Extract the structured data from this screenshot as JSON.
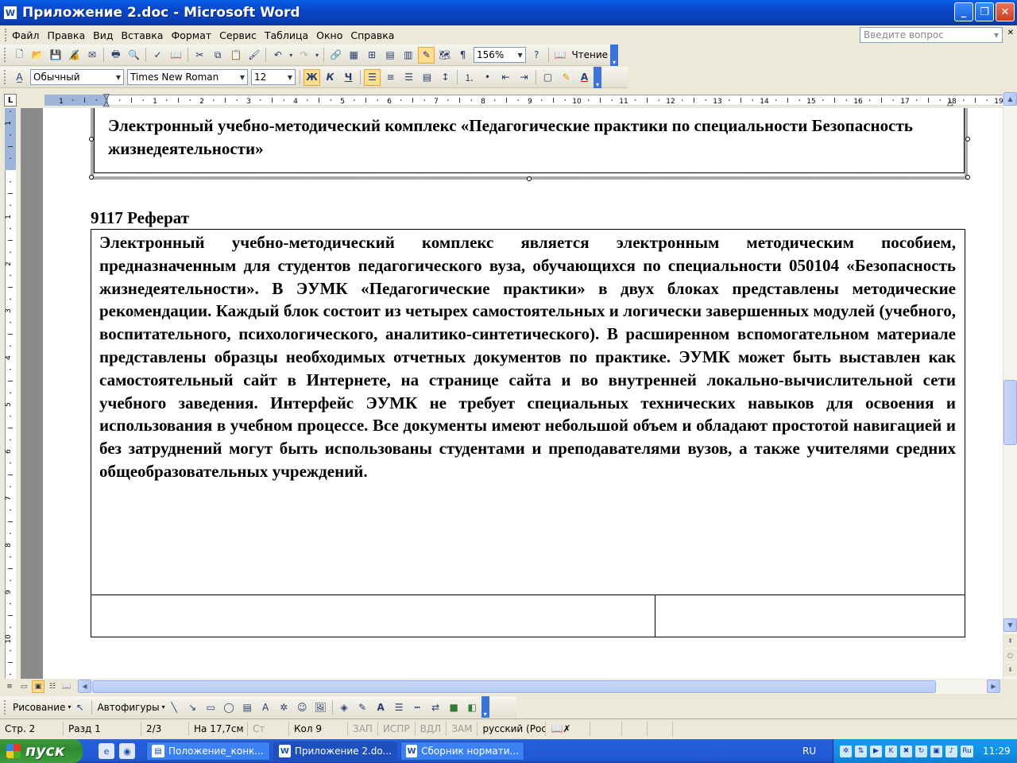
{
  "window": {
    "title": "Приложение 2.doc - Microsoft Word",
    "app_icon": "word-doc-icon"
  },
  "menu": {
    "items": [
      "Файл",
      "Правка",
      "Вид",
      "Вставка",
      "Формат",
      "Сервис",
      "Таблица",
      "Окно",
      "Справка"
    ],
    "ask_placeholder": "Введите вопрос"
  },
  "standard_toolbar": {
    "zoom": "156%",
    "read_label": "Чтение"
  },
  "format_toolbar": {
    "style": "Обычный",
    "font": "Times New Roman",
    "size": "12",
    "bold": "Ж",
    "italic": "К",
    "underline": "Ч"
  },
  "ruler": {
    "corner": "L",
    "numbers": [
      "1",
      "1",
      "2",
      "3",
      "4",
      "5",
      "6",
      "7",
      "8",
      "9",
      "10",
      "11",
      "12",
      "13",
      "14",
      "15",
      "16",
      "17",
      "18",
      "19"
    ],
    "vnumbers": [
      "1",
      "1",
      "2",
      "3",
      "4",
      "5",
      "6",
      "7",
      "8",
      "9",
      "10",
      "11",
      "12"
    ]
  },
  "document": {
    "header_text": "Электронный учебно-методический комплекс «Педагогические практики по специальности Безопасность жизнедеятельности»",
    "section_title": "9117 Реферат",
    "body": "Электронный учебно-методический комплекс является электронным методическим пособием, предназначенным для студентов педагогического вуза, обучающихся по специальности 050104 «Безопасность жизнедеятельности». В ЭУМК «Педагогические практики» в двух блоках представлены методические рекомендации. Каждый блок состоит из четырех самостоятельных и логически завершенных модулей (учебного, воспитательного, психологического, аналитико-синтетического). В расширенном вспомогательном материале представлены образцы необходимых отчетных документов по практике. ЭУМК может быть выставлен как самостоятельный сайт в Интернете, на странице сайта и во внутренней локально-вычислительной сети учебного заведения. Интерфейс ЭУМК не требует специальных технических навыков для освоения и использования в учебном процессе. Все документы имеют небольшой объем и  обладают простотой навигацией и без затруднений могут быть использованы студентами и преподавателями вузов, а также учителями средних общеобразовательных учреждений."
  },
  "drawing_toolbar": {
    "draw_label": "Рисование",
    "autoshapes_label": "Автофигуры"
  },
  "status": {
    "page": "Стр. 2",
    "section": "Разд 1",
    "pages": "2/3",
    "position": "На 17,7см",
    "line": "Ст",
    "column": "Кол 9",
    "rec": "ЗАП",
    "trk": "ИСПР",
    "ext": "ВДЛ",
    "ovr": "ЗАМ",
    "language": "русский (Рос"
  },
  "taskbar": {
    "start": "пуск",
    "tasks": [
      "Положение_конк...",
      "Приложение 2.do...",
      "Сборник нормати..."
    ],
    "lang": "RU",
    "clock": "11:29",
    "tray_label": "Ru"
  }
}
